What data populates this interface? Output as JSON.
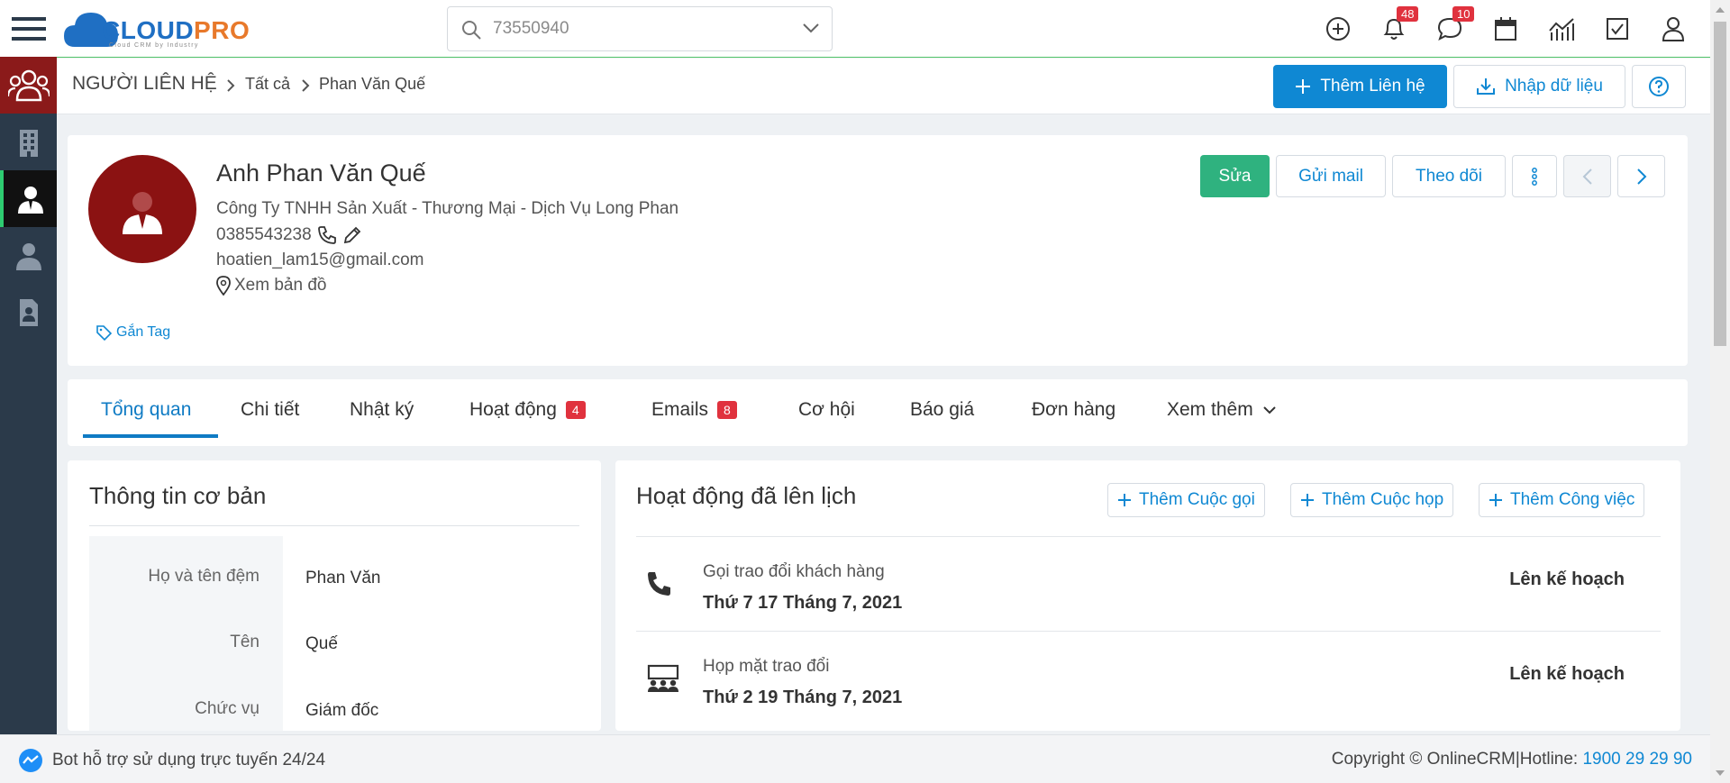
{
  "app": {
    "logo_main_a": "CLOUD",
    "logo_main_b": "PRO",
    "logo_sub": "Cloud CRM by Industry",
    "brand_blue": "#1f6fc3",
    "brand_orange": "#e8792b"
  },
  "search": {
    "value": "73550940"
  },
  "topbar": {
    "notifications_count": "48",
    "messages_count": "10"
  },
  "sidebar": {
    "items": [
      {
        "icon": "menu-icon"
      },
      {
        "icon": "contacts-group-icon"
      },
      {
        "icon": "building-icon"
      },
      {
        "icon": "contact-person-icon"
      },
      {
        "icon": "user-icon"
      },
      {
        "icon": "document-user-icon"
      }
    ]
  },
  "breadcrumb": {
    "root": "NGƯỜI LIÊN HỆ",
    "level1": "Tất cả",
    "level2": "Phan Văn Quế"
  },
  "header_actions": {
    "add_contact": "Thêm Liên hệ",
    "import": "Nhập dữ liệu"
  },
  "profile": {
    "name": "Anh Phan Văn Quế",
    "company": "Công Ty TNHH Sản Xuất - Thương Mại - Dịch Vụ Long Phan",
    "phone": "0385543238",
    "email": "hoatien_lam15@gmail.com",
    "map": "Xem bản đồ",
    "tag": "Gắn Tag",
    "edit": "Sửa",
    "send_mail": "Gửi mail",
    "follow": "Theo dõi"
  },
  "tabs": [
    {
      "label": "Tổng quan"
    },
    {
      "label": "Chi tiết"
    },
    {
      "label": "Nhật ký"
    },
    {
      "label": "Hoạt động",
      "badge": "4"
    },
    {
      "label": "Emails",
      "badge": "8"
    },
    {
      "label": "Cơ hội"
    },
    {
      "label": "Báo giá"
    },
    {
      "label": "Đơn hàng"
    },
    {
      "label": "Xem thêm"
    }
  ],
  "basic_info": {
    "title": "Thông tin cơ bản",
    "fields": [
      {
        "label": "Họ và tên đệm",
        "value": "Phan Văn"
      },
      {
        "label": "Tên",
        "value": "Quế"
      },
      {
        "label": "Chức vụ",
        "value": "Giám đốc"
      }
    ]
  },
  "activities": {
    "title": "Hoạt động đã lên lịch",
    "add_call": "Thêm Cuộc gọi",
    "add_meeting": "Thêm Cuộc họp",
    "add_task": "Thêm Công việc",
    "items": [
      {
        "icon": "phone-icon",
        "title": "Gọi trao đổi khách hàng",
        "date": "Thứ 7 17 Tháng 7, 2021",
        "status": "Lên kế hoạch"
      },
      {
        "icon": "meeting-icon",
        "title": "Họp mặt trao đổi",
        "date": "Thứ 2 19 Tháng 7, 2021",
        "status": "Lên kế hoạch"
      }
    ]
  },
  "footer": {
    "bot": "Bot hỗ trợ sử dụng trực tuyến 24/24",
    "copyright": "Copyright © OnlineCRM",
    "hotline_label": "Hotline:",
    "hotline": "1900 29 29 90"
  }
}
